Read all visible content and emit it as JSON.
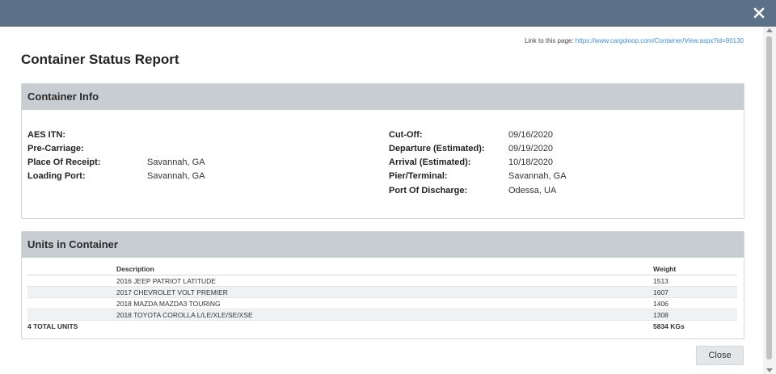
{
  "header": {
    "close_icon": "close-x-icon"
  },
  "link": {
    "label": "Link to this page:",
    "url": "https://www.cargoloop.com/Container/View.aspx?id=90130"
  },
  "page_title": "Container Status Report",
  "container_info": {
    "heading": "Container Info",
    "left": [
      {
        "label": "AES ITN:",
        "value": ""
      },
      {
        "label": "Pre-Carriage:",
        "value": ""
      },
      {
        "label": "Place Of Receipt:",
        "value": "Savannah, GA"
      },
      {
        "label": "Loading Port:",
        "value": "Savannah, GA"
      }
    ],
    "right": [
      {
        "label": "Cut-Off:",
        "value": "09/16/2020"
      },
      {
        "label": "Departure (Estimated):",
        "value": "09/19/2020"
      },
      {
        "label": "Arrival (Estimated):",
        "value": "10/18/2020"
      },
      {
        "label": "Pier/Terminal:",
        "value": "Savannah, GA"
      },
      {
        "label": "Port Of Discharge:",
        "value": "Odessa, UA"
      }
    ]
  },
  "units": {
    "heading": "Units in Container",
    "columns": {
      "description": "Description",
      "weight": "Weight"
    },
    "rows": [
      {
        "description": "2016 JEEP PATRIOT LATITUDE",
        "weight": "1513"
      },
      {
        "description": "2017 CHEVROLET VOLT PREMIER",
        "weight": "1607"
      },
      {
        "description": "2018 MAZDA MAZDA3 TOURING",
        "weight": "1406"
      },
      {
        "description": "2018 TOYOTA COROLLA L/LE/XLE/SE/XSE",
        "weight": "1308"
      }
    ],
    "total_label": "4 TOTAL UNITS",
    "total_weight": "5834 KGs"
  },
  "footer": {
    "close_label": "Close"
  }
}
